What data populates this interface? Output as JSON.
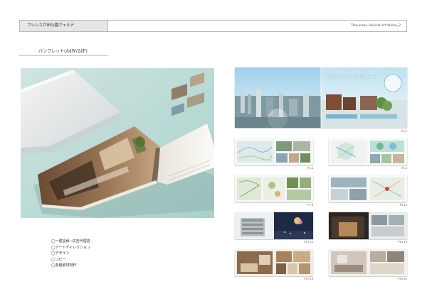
{
  "header": {
    "tab_label": "プレシス戸田公園ヴェルデ",
    "right_label": "Tatsunobu Hosoda Art Works_2"
  },
  "section": {
    "title": "パンフレット(A4W/24P)"
  },
  "credits": [
    "◯一建設様→広告代理店",
    "◯アートディレクション",
    "◯デザイン",
    "◯コピー",
    "◯各種素材制作"
  ],
  "cover": {
    "headline": "SMART & SMOOTH"
  },
  "spreads": [
    {
      "caption": "P1-2"
    },
    {
      "caption": "P3-4"
    },
    {
      "caption": "P5-6"
    },
    {
      "caption": "P7-8"
    },
    {
      "caption": "P9-10"
    },
    {
      "caption": "P11-12"
    },
    {
      "caption": "P13-14"
    },
    {
      "caption": "P17-18"
    },
    {
      "caption": "P19-20"
    }
  ]
}
